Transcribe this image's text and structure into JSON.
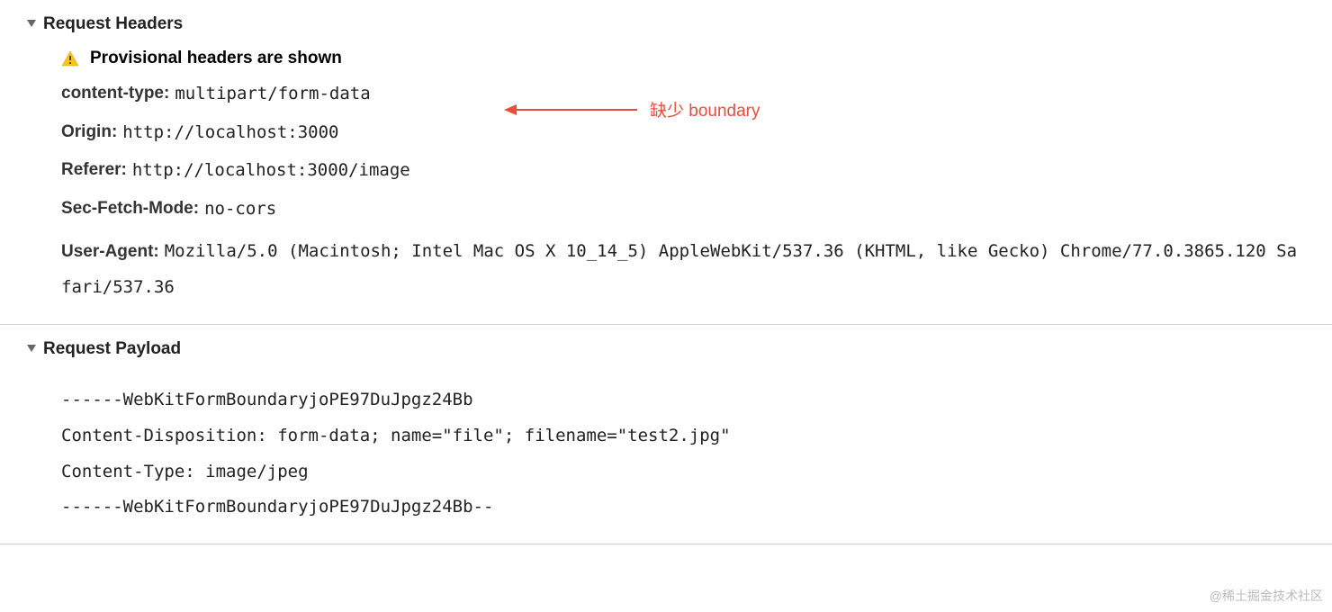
{
  "sections": {
    "requestHeaders": {
      "title": "Request Headers",
      "warning": "Provisional headers are shown",
      "headers": [
        {
          "name": "content-type:",
          "value": "multipart/form-data"
        },
        {
          "name": "Origin:",
          "value": "http://localhost:3000"
        },
        {
          "name": "Referer:",
          "value": "http://localhost:3000/image"
        },
        {
          "name": "Sec-Fetch-Mode:",
          "value": "no-cors"
        },
        {
          "name": "User-Agent:",
          "value": "Mozilla/5.0 (Macintosh; Intel Mac OS X 10_14_5) AppleWebKit/537.36 (KHTML, like Gecko) Chrome/77.0.3865.120 Safari/537.36"
        }
      ]
    },
    "requestPayload": {
      "title": "Request Payload",
      "lines": [
        "------WebKitFormBoundaryjoPE97DuJpgz24Bb",
        "Content-Disposition: form-data; name=\"file\"; filename=\"test2.jpg\"",
        "Content-Type: image/jpeg",
        "",
        "",
        "------WebKitFormBoundaryjoPE97DuJpgz24Bb--"
      ]
    }
  },
  "annotation": {
    "text": "缺少 boundary",
    "color": "#e74c3c"
  },
  "watermark": "@稀土掘金技术社区"
}
